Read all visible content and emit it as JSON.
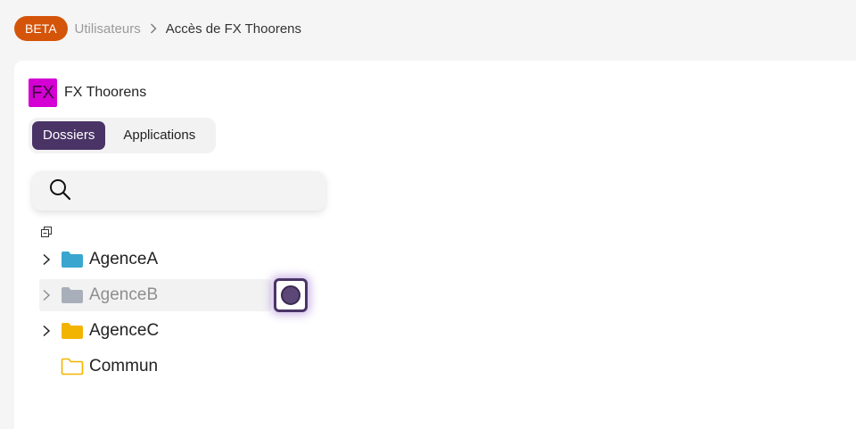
{
  "breadcrumb": {
    "badge": "BETA",
    "parent": "Utilisateurs",
    "current": "Accès de FX Thoorens"
  },
  "user": {
    "initials": "FX",
    "name": "FX Thoorens",
    "avatar_color": "#d400d4"
  },
  "tabs": [
    {
      "label": "Dossiers",
      "active": true
    },
    {
      "label": "Applications",
      "active": false
    }
  ],
  "search": {
    "placeholder": "",
    "value": ""
  },
  "tree": {
    "items": [
      {
        "label": "AgenceA",
        "expandable": true,
        "folder_color": "#3aa6d0",
        "icon": "folder-filled-icon"
      },
      {
        "label": "AgenceB",
        "expandable": true,
        "folder_color": "#a9afba",
        "icon": "folder-filled-icon",
        "state": "hover"
      },
      {
        "label": "AgenceC",
        "expandable": true,
        "folder_color": "#f2b400",
        "icon": "folder-filled-icon"
      },
      {
        "label": "Commun",
        "expandable": false,
        "folder_color": "#f2b400",
        "icon": "folder-outline-icon"
      }
    ]
  },
  "colors": {
    "accent": "#4a3466",
    "beta": "#d4540a"
  }
}
